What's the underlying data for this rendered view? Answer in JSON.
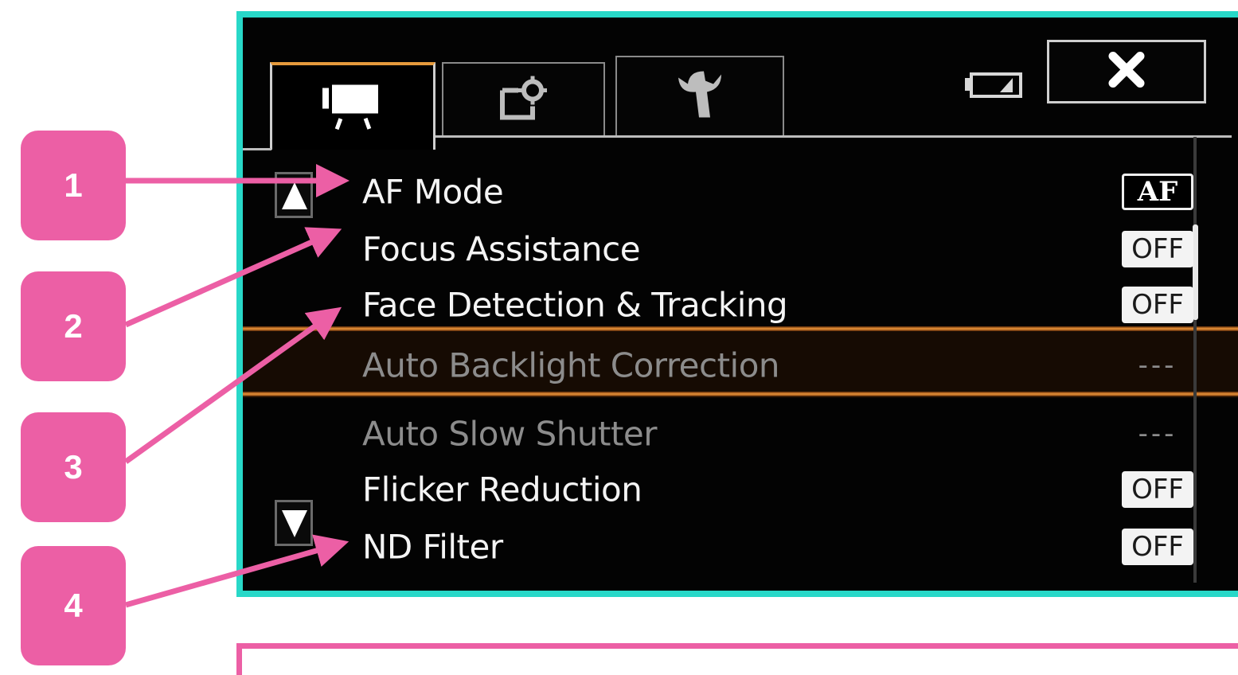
{
  "callouts": [
    "1",
    "2",
    "3",
    "4"
  ],
  "tabs": [
    {
      "name": "movie",
      "icon": "movie-camera-icon",
      "active": true
    },
    {
      "name": "recording-setup",
      "icon": "recording-setup-icon",
      "active": false
    },
    {
      "name": "setup",
      "icon": "wrench-icon",
      "active": false
    }
  ],
  "status": {
    "battery_icon": "battery-icon",
    "close_icon": "close-icon"
  },
  "menu": {
    "items": [
      {
        "label": "AF Mode",
        "value": "AF",
        "enabled": true
      },
      {
        "label": "Focus Assistance",
        "value": "OFF",
        "enabled": true
      },
      {
        "label": "Face Detection & Tracking",
        "value": "OFF",
        "enabled": true
      },
      {
        "label": "Auto Backlight Correction",
        "value": "---",
        "enabled": false
      },
      {
        "label": "Auto Slow Shutter",
        "value": "---",
        "enabled": false
      },
      {
        "label": "Flicker Reduction",
        "value": "OFF",
        "enabled": true
      },
      {
        "label": "ND Filter",
        "value": "OFF",
        "enabled": true
      }
    ]
  },
  "colors": {
    "callout": "#ec5fa5",
    "screen_border": "#28d8c8",
    "highlight": "#f0963a",
    "screen_bg": "#030303"
  }
}
